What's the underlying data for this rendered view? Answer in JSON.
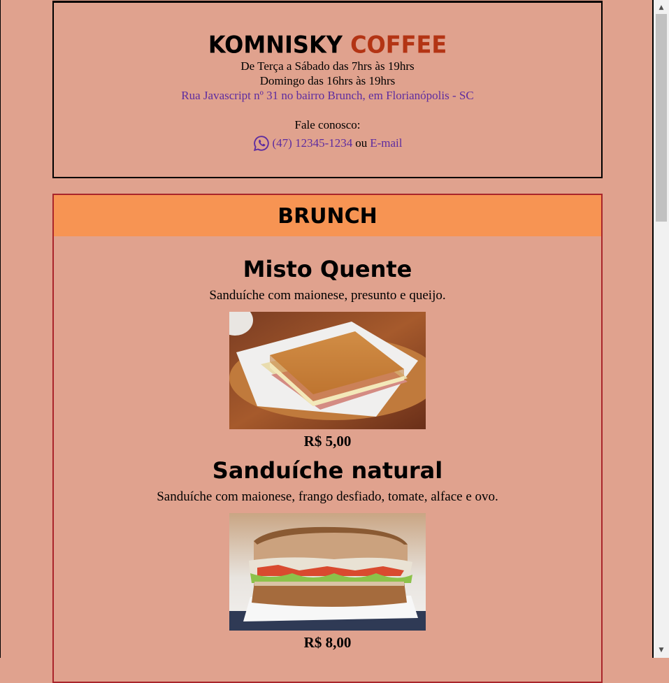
{
  "header": {
    "brand_main": "KOMNISKY",
    "brand_accent": "COFFEE",
    "hours_1": "De Terça a Sábado das 7hrs às 19hrs",
    "hours_2": "Domingo das 16hrs às 19hrs",
    "address": "Rua Javascript nº 31 no bairro Brunch, em Florianópolis - SC",
    "contact_label": "Fale conosco:",
    "phone": "(47) 12345-1234",
    "or_text": "ou",
    "email_label": "E-mail",
    "phone_icon": "whatsapp-icon"
  },
  "menu": {
    "section_title": "BRUNCH",
    "items": [
      {
        "title": "Misto Quente",
        "description": "Sanduíche com maionese, presunto e queijo.",
        "price": "R$ 5,00",
        "image": "toasted-ham-cheese-sandwich"
      },
      {
        "title": "Sanduíche natural",
        "description": "Sanduíche com maionese, frango desfiado, tomate, alface e ovo.",
        "price": "R$ 8,00",
        "image": "chicken-salad-sandwich"
      }
    ]
  },
  "colors": {
    "background": "#e0a28e",
    "accent": "#b33414",
    "section_header": "#f79453",
    "link": "#5d2ca0",
    "menu_border": "#a9252b"
  }
}
